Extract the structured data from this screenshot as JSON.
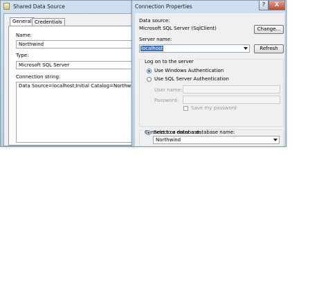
{
  "shared_ds": {
    "title": "Shared Data Source",
    "tabs": [
      "General",
      "Credentials"
    ],
    "name_label": "Name:",
    "name_value": "Northwind",
    "type_label": "Type:",
    "type_value": "Microsoft SQL Server",
    "conn_label": "Connection string:",
    "conn_value": "Data Source=localhost;Initial Catalog=Northwind"
  },
  "conn_props": {
    "title": "Connection Properties",
    "data_source_label": "Data source:",
    "data_source_value": "Microsoft SQL Server (SqlClient)",
    "change_button": "Change...",
    "server_name_label": "Server name:",
    "server_name_value": "localhost",
    "refresh_button": "Refresh",
    "logon_group_label": "Log on to the server",
    "windows_auth_label": "Use Windows Authentication",
    "sql_auth_label": "Use SQL Server Authentication",
    "user_name_label": "User name:",
    "password_label": "Password:",
    "save_password_label": "Save my password",
    "connect_group_label": "Connect to a database",
    "select_db_label": "Select or enter a database name:",
    "db_value": "Northwind"
  },
  "icons": {
    "app_icon": "report-icon",
    "help": "?",
    "close": "X"
  }
}
